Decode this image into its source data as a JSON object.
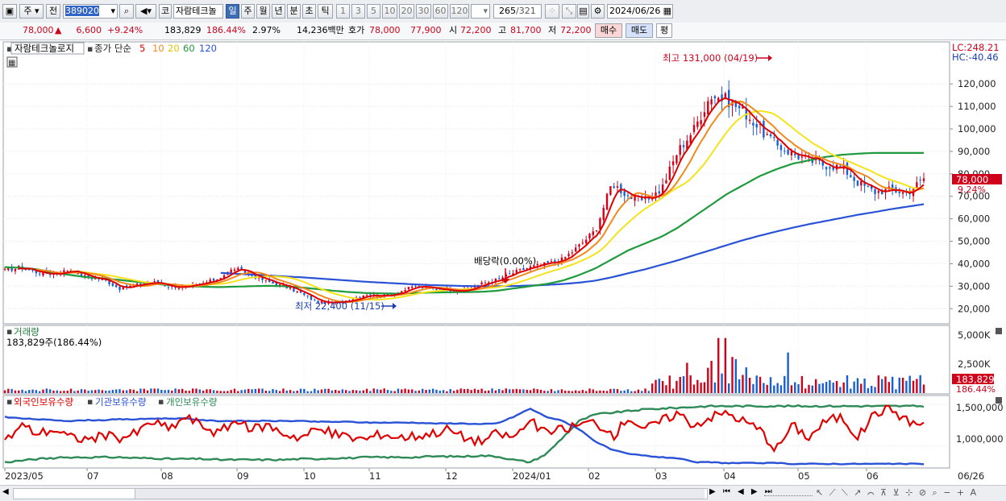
{
  "toolbar": {
    "market": "주",
    "prev": "전",
    "code": "389020",
    "kospi": "코",
    "name": "자람테크놀",
    "periods": [
      "일",
      "주",
      "월",
      "년",
      "분",
      "초",
      "틱"
    ],
    "selected_period": "일",
    "intervals": [
      "1",
      "3",
      "5",
      "10",
      "20",
      "30",
      "60",
      "120"
    ],
    "count": "265",
    "total": "/321",
    "date": "2024/06/26"
  },
  "quote": {
    "price": "78,000",
    "change": "6,600",
    "change_pct": "+9.24%",
    "volume": "183,829",
    "volume_ratio": "186.44%",
    "turnover": "2.97%",
    "amount": "14,236백만",
    "ask_label": "호가",
    "ask": "78,000",
    "bid": "77,900",
    "open_label": "시",
    "open": "72,200",
    "high_label": "고",
    "high": "81,700",
    "low_label": "저",
    "low": "72,200",
    "buy": "매수",
    "sell": "매도",
    "eval": "평"
  },
  "colors": {
    "up": "#d0021b",
    "down": "#1a5fd0",
    "ma5": "#e00000",
    "ma10": "#f08a1c",
    "ma20": "#f5e31a",
    "ma60": "#1f9a3c",
    "ma120": "#2a52d6",
    "foreign": "#e00000",
    "institution": "#2a52d6",
    "individual": "#2e8b57"
  },
  "chart_data": [
    {
      "type": "candlestick",
      "panel": "price",
      "legend": {
        "name": "자람테크놀로지",
        "series_label": "종가 단순",
        "ma_periods": [
          "5",
          "10",
          "20",
          "60",
          "120"
        ]
      },
      "right_top": {
        "lc": "LC:248.21",
        "hc": "HC:-40.46"
      },
      "ylim": [
        14000,
        138000
      ],
      "y_ticks": [
        20000,
        30000,
        40000,
        50000,
        60000,
        70000,
        80000,
        90000,
        100000,
        110000,
        120000
      ],
      "y_tick_labels": [
        "20,000",
        "30,000",
        "40,000",
        "50,000",
        "60,000",
        "70,000",
        "80,000",
        "90,000",
        "100,000",
        "110,000",
        "120,000"
      ],
      "current_price_label": "78,000",
      "current_pct_label": "9.24%",
      "annotations": {
        "high": "최고 131,000 (04/19)",
        "low": "최저 22,400 (11/15)",
        "dividend": "배당락(0.00%)"
      },
      "anchor_series": [
        {
          "name": "close",
          "values": [
            37000,
            38500,
            36000,
            35500,
            37500,
            34000,
            33000,
            29000,
            30500,
            32000,
            30000,
            29500,
            31000,
            33500,
            38000,
            35000,
            32000,
            30000,
            27000,
            23000,
            22400,
            24000,
            26500,
            25500,
            27500,
            30000,
            29000,
            28500,
            28000,
            31000,
            33000,
            36000,
            38500,
            40000,
            42000,
            48000,
            55000,
            76000,
            70000,
            68000,
            73000,
            90000,
            100000,
            115000,
            113000,
            108000,
            100000,
            93000,
            89000,
            86000,
            84000,
            83000,
            76000,
            72000,
            73000,
            71500,
            78000
          ]
        },
        {
          "name": "ma60",
          "values": [
            38500,
            38200,
            37500,
            36000,
            35000,
            34000,
            33500,
            32800,
            32000,
            31200,
            30500,
            30000,
            29800,
            29600,
            29800,
            30000,
            30200,
            30000,
            29500,
            28800,
            28000,
            27400,
            27000,
            26800,
            26700,
            27000,
            27200,
            27300,
            27400,
            27500,
            28000,
            29000,
            30000,
            31000,
            32500,
            35000,
            38000,
            42000,
            46000,
            49000,
            52000,
            56000,
            61000,
            66000,
            71000,
            75000,
            79000,
            82000,
            84500,
            86000,
            87500,
            88500,
            89000,
            89300,
            89300,
            89300,
            89300
          ]
        },
        {
          "name": "ma120",
          "values": [
            null,
            null,
            null,
            null,
            null,
            null,
            null,
            null,
            null,
            null,
            null,
            null,
            null,
            36000,
            35600,
            35200,
            34800,
            34400,
            34000,
            33500,
            33000,
            32500,
            32000,
            31600,
            31200,
            30800,
            30500,
            30300,
            30100,
            30000,
            30000,
            30100,
            30300,
            30600,
            31000,
            31600,
            32500,
            34000,
            35800,
            37500,
            39500,
            41500,
            43800,
            46000,
            48300,
            50500,
            52500,
            54300,
            56000,
            57600,
            59000,
            60400,
            61800,
            63000,
            64300,
            65400,
            66500
          ]
        },
        {
          "name": "foreign_holdings",
          "values": [
            1.05,
            1.25,
            1.15,
            1.2,
            1.1,
            1.08,
            1.12,
            1.1,
            1.15,
            1.3,
            1.2,
            1.35,
            1.25,
            1.15,
            1.3,
            1.2,
            1.25,
            1.15,
            1.1,
            1.2,
            1.15,
            1.1,
            1.08,
            1.15,
            1.1,
            1.12,
            1.15,
            1.2,
            1.1,
            1.05,
            1.15,
            1.1,
            1.3,
            1.15,
            1.2,
            1.25,
            1.3,
            1.1,
            1.35,
            1.2,
            1.3,
            1.4,
            1.25,
            1.35,
            1.4,
            1.3,
            1.2,
            0.95,
            1.25,
            1.1,
            1.3,
            1.35,
            1.1,
            1.4,
            1.45,
            1.3,
            1.25
          ]
        },
        {
          "name": "institution_holdings",
          "values": [
            1.35,
            1.33,
            1.32,
            1.31,
            1.3,
            1.31,
            1.31,
            1.32,
            1.32,
            1.33,
            1.33,
            1.33,
            1.31,
            1.3,
            1.3,
            1.3,
            1.3,
            1.3,
            1.3,
            1.29,
            1.29,
            1.29,
            1.28,
            1.28,
            1.28,
            1.28,
            1.27,
            1.27,
            1.27,
            1.26,
            1.27,
            1.35,
            1.45,
            1.35,
            1.3,
            1.2,
            1.05,
            0.95,
            0.9,
            0.88,
            0.86,
            0.85,
            0.8,
            0.8,
            0.79,
            0.79,
            0.79,
            0.79,
            0.78,
            0.78,
            0.78,
            0.78,
            0.78,
            0.78,
            0.78,
            0.78,
            0.78
          ]
        },
        {
          "name": "individual_holdings",
          "values": [
            0.8,
            0.82,
            0.84,
            0.85,
            0.86,
            0.86,
            0.86,
            0.86,
            0.85,
            0.85,
            0.84,
            0.84,
            0.84,
            0.83,
            0.83,
            0.83,
            0.83,
            0.83,
            0.84,
            0.84,
            0.85,
            0.85,
            0.86,
            0.86,
            0.86,
            0.86,
            0.87,
            0.87,
            0.87,
            0.88,
            0.87,
            0.83,
            0.8,
            0.9,
            1.1,
            1.3,
            1.38,
            1.4,
            1.42,
            1.44,
            1.45,
            1.46,
            1.47,
            1.48,
            1.48,
            1.48,
            1.48,
            1.48,
            1.48,
            1.48,
            1.48,
            1.48,
            1.48,
            1.48,
            1.48,
            1.48,
            1.48
          ]
        }
      ]
    },
    {
      "type": "bar",
      "panel": "volume",
      "title": "거래량",
      "subtitle": "183,829주(186.44%)",
      "y_tick_labels": [
        "5,000K",
        "2,500K"
      ],
      "current_label": "183,829",
      "current_pct_label": "186.44%"
    },
    {
      "type": "line",
      "panel": "holdings",
      "series": [
        {
          "name": "외국인보유수량"
        },
        {
          "name": "기관보유수량"
        },
        {
          "name": "개인보유수량"
        }
      ],
      "y_tick_labels": [
        "1,500,000",
        "1,000,000"
      ],
      "x_tick_labels": [
        "2023/05",
        "07",
        "08",
        "09",
        "10",
        "11",
        "12",
        "2024/01",
        "02",
        "03",
        "04",
        "05",
        "06"
      ],
      "x_tick_right": "06/26"
    }
  ]
}
